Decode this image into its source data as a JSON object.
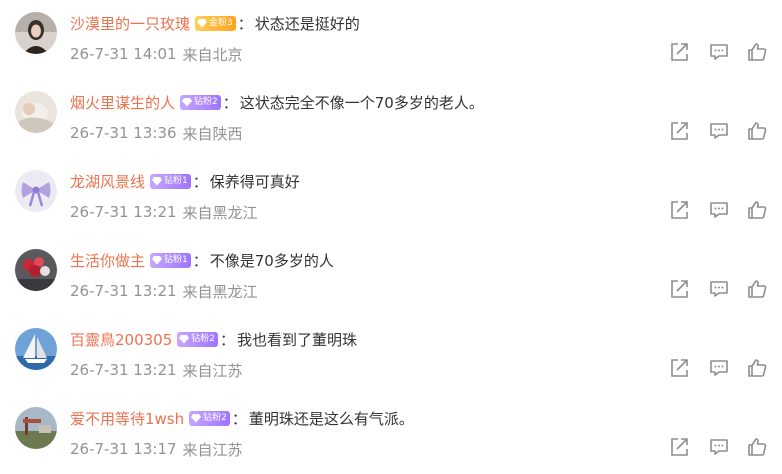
{
  "comments": [
    {
      "username": "沙漠里的一只玫瑰",
      "badge": {
        "label": "金粉3",
        "style": "gold"
      },
      "colon": "：",
      "text": "状态还是挺好的",
      "date": "26-7-31 14:01",
      "location": "来自北京",
      "avatar": "woman-portrait-avatar"
    },
    {
      "username": "烟火里谋生的人",
      "badge": {
        "label": "钻粉2",
        "style": "purple"
      },
      "colon": "：",
      "text": "这状态完全不像一个70多岁的老人。",
      "date": "26-7-31 13:36",
      "location": "来自陕西",
      "avatar": "baby-photo-avatar"
    },
    {
      "username": "龙湖风景线",
      "badge": {
        "label": "钻粉1",
        "style": "purple"
      },
      "colon": "：",
      "text": "保养得可真好",
      "date": "26-7-31 13:21",
      "location": "来自黑龙江",
      "avatar": "purple-bow-avatar"
    },
    {
      "username": "生活你做主",
      "badge": {
        "label": "钻粉1",
        "style": "purple"
      },
      "colon": "：",
      "text": "不像是70多岁的人",
      "date": "26-7-31 13:21",
      "location": "来自黑龙江",
      "avatar": "flowers-avatar"
    },
    {
      "username": "百靈鳥200305",
      "badge": {
        "label": "钻粉2",
        "style": "purple"
      },
      "colon": "：",
      "text": "我也看到了董明珠",
      "date": "26-7-31 13:21",
      "location": "来自江苏",
      "avatar": "sailboat-avatar"
    },
    {
      "username": "爱不用等待1wsh",
      "badge": {
        "label": "钻粉2",
        "style": "purple"
      },
      "colon": "：",
      "text": "董明珠还是这么有气派。",
      "date": "26-7-31 13:17",
      "location": "来自江苏",
      "avatar": "landscape-avatar"
    }
  ],
  "actions": {
    "share_icon": "share-icon",
    "reply_icon": "comment-icon",
    "like_icon": "thumbs-up-icon",
    "icon_color": "#8e8e8e"
  },
  "colors": {
    "username": "#eb7350",
    "text": "#333333",
    "meta": "#939393",
    "badge_purple": "#a880ff",
    "badge_gold": "#ffb02e"
  }
}
